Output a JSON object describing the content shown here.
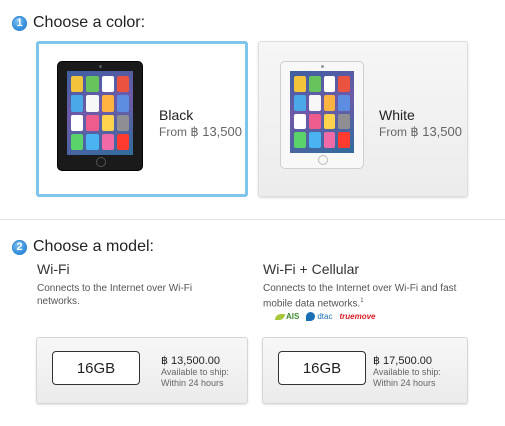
{
  "step1": {
    "number": "1",
    "title": "Choose a color:"
  },
  "colors": [
    {
      "name": "Black",
      "price_prefix": "From ",
      "price": "฿ 13,500",
      "selected": true
    },
    {
      "name": "White",
      "price_prefix": "From ",
      "price": "฿ 13,500",
      "selected": false
    }
  ],
  "step2": {
    "number": "2",
    "title": "Choose a model:"
  },
  "models": [
    {
      "title": "Wi-Fi",
      "description": "Connects to the Internet over Wi-Fi networks.",
      "capacity": "16GB",
      "price": "฿ 13,500.00",
      "ship_line1": "Available to ship:",
      "ship_line2": "Within 24 hours"
    },
    {
      "title": "Wi-Fi + Cellular",
      "description": "Connects to the Internet over Wi-Fi and fast mobile data networks.",
      "footnote": "1",
      "carriers": [
        "AIS",
        "dtac",
        "truemove"
      ],
      "capacity": "16GB",
      "price": "฿ 17,500.00",
      "ship_line1": "Available to ship:",
      "ship_line2": "Within 24 hours"
    }
  ],
  "colors_theme": {
    "accent": "#7fc4ea",
    "step_badge": "#2a86d8"
  }
}
